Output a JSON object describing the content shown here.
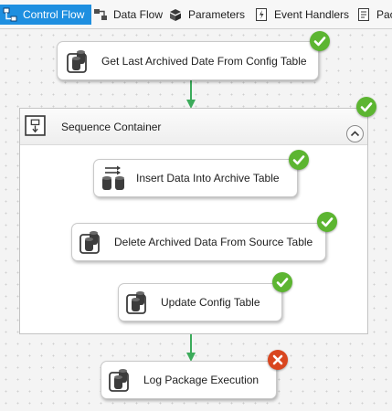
{
  "tabs": [
    {
      "label": "Control Flow",
      "icon": "control-flow-icon",
      "active": true
    },
    {
      "label": "Data Flow",
      "icon": "data-flow-icon",
      "active": false
    },
    {
      "label": "Parameters",
      "icon": "parameters-icon",
      "active": false
    },
    {
      "label": "Event Handlers",
      "icon": "event-handlers-icon",
      "active": false
    },
    {
      "label": "Pac",
      "icon": "package-explorer-icon",
      "active": false
    }
  ],
  "tasks": {
    "get_last_archived": {
      "label": "Get Last Archived Date From Config Table",
      "icon": "execute-sql-task-icon",
      "status": "success"
    },
    "insert_archive": {
      "label": "Insert Data Into Archive Table",
      "icon": "transfer-data-icon",
      "status": "success"
    },
    "delete_archived": {
      "label": "Delete Archived Data From Source Table",
      "icon": "execute-sql-task-icon",
      "status": "success"
    },
    "update_config": {
      "label": "Update Config Table",
      "icon": "execute-sql-task-icon",
      "status": "success"
    },
    "log_execution": {
      "label": "Log Package Execution",
      "icon": "execute-sql-task-icon",
      "status": "failure"
    }
  },
  "container": {
    "label": "Sequence Container",
    "icon": "sequence-container-icon",
    "status": "success"
  },
  "colors": {
    "active_tab": "#1e8fe0",
    "success": "#5cb531",
    "failure": "#d9461f",
    "precedence_arrow": "#3cab5b"
  }
}
